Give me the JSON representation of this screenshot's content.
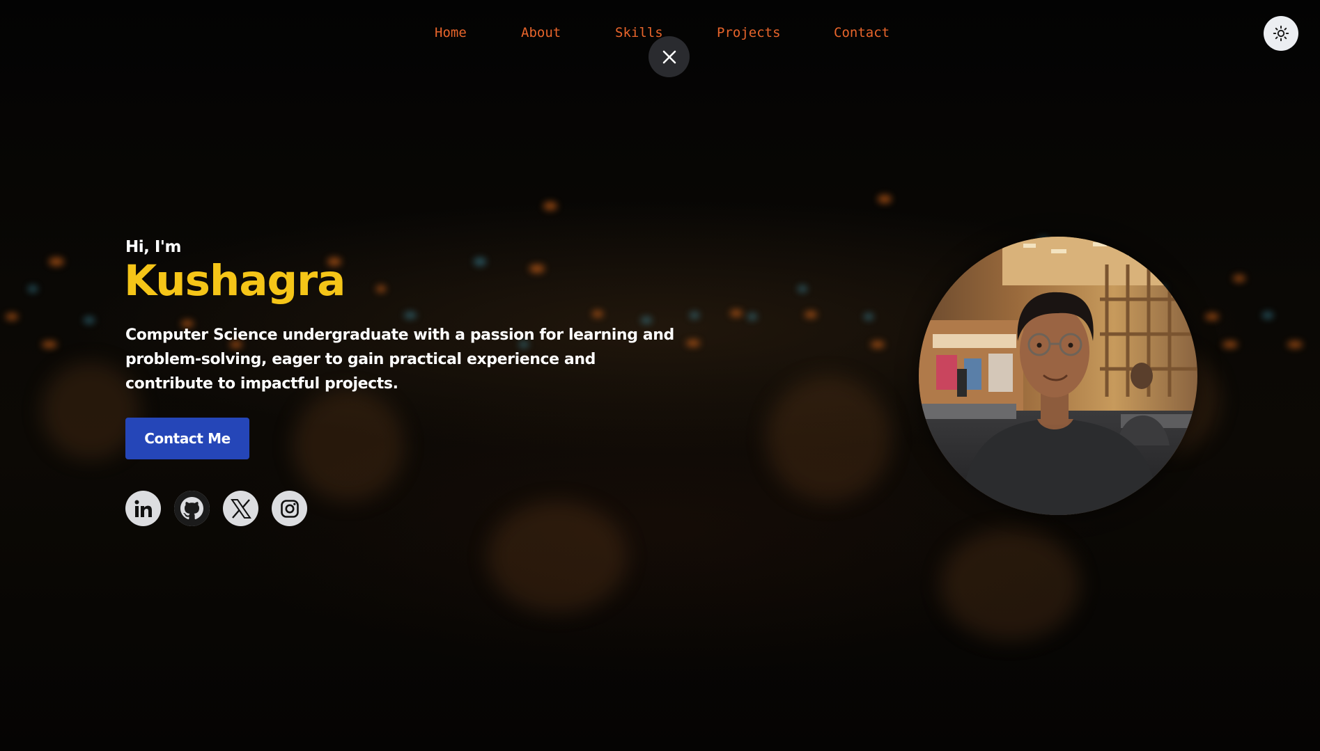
{
  "nav": {
    "items": [
      {
        "label": "Home"
      },
      {
        "label": "About"
      },
      {
        "label": "Skills"
      },
      {
        "label": "Projects"
      },
      {
        "label": "Contact"
      }
    ],
    "close_icon": "close-icon",
    "theme_icon": "sun-icon"
  },
  "hero": {
    "greeting": "Hi, I'm",
    "name": "Kushagra",
    "bio": "Computer Science undergraduate with a passion for learning and problem-solving, eager to gain practical experience and contribute to impactful projects.",
    "cta_label": "Contact Me",
    "socials": [
      {
        "icon": "linkedin-icon"
      },
      {
        "icon": "github-icon"
      },
      {
        "icon": "x-icon"
      },
      {
        "icon": "instagram-icon"
      }
    ],
    "photo": "profile-photo"
  },
  "colors": {
    "accent_name": "#f5c518",
    "nav_link": "#e8652b",
    "cta_background": "#2546b8",
    "background": "#050505"
  }
}
